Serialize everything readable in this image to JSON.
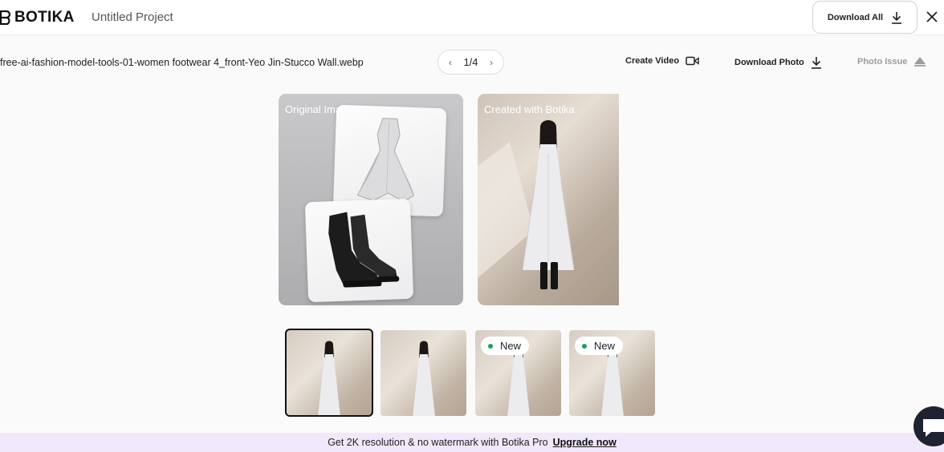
{
  "header": {
    "brand": "BOTIKA",
    "project_title": "Untitled Project",
    "download_all_label": "Download All"
  },
  "toolbar": {
    "filename": "free-ai-fashion-model-tools-01-women footwear 4_front-Yeo Jin-Stucco Wall.webp",
    "pager_count": "1/4",
    "create_video_label": "Create Video",
    "download_photo_label": "Download Photo",
    "photo_issue_label": "Photo Issue"
  },
  "cards": {
    "original_label": "Original Image",
    "created_label": "Created with Botika"
  },
  "thumbnails": [
    {
      "selected": true,
      "badge": ""
    },
    {
      "selected": false,
      "badge": ""
    },
    {
      "selected": false,
      "badge": "New"
    },
    {
      "selected": false,
      "badge": "New"
    }
  ],
  "promo": {
    "text": "Get 2K resolution & no watermark with Botika Pro",
    "link_label": "Upgrade now"
  },
  "colors": {
    "accent_dot": "#1aa260",
    "promo_bg": "#f1e8fb"
  },
  "icons": [
    "botika-logo-icon",
    "download-icon",
    "close-icon",
    "chevron-left-icon",
    "chevron-right-icon",
    "video-camera-icon",
    "warning-triangle-icon",
    "chat-icon"
  ]
}
